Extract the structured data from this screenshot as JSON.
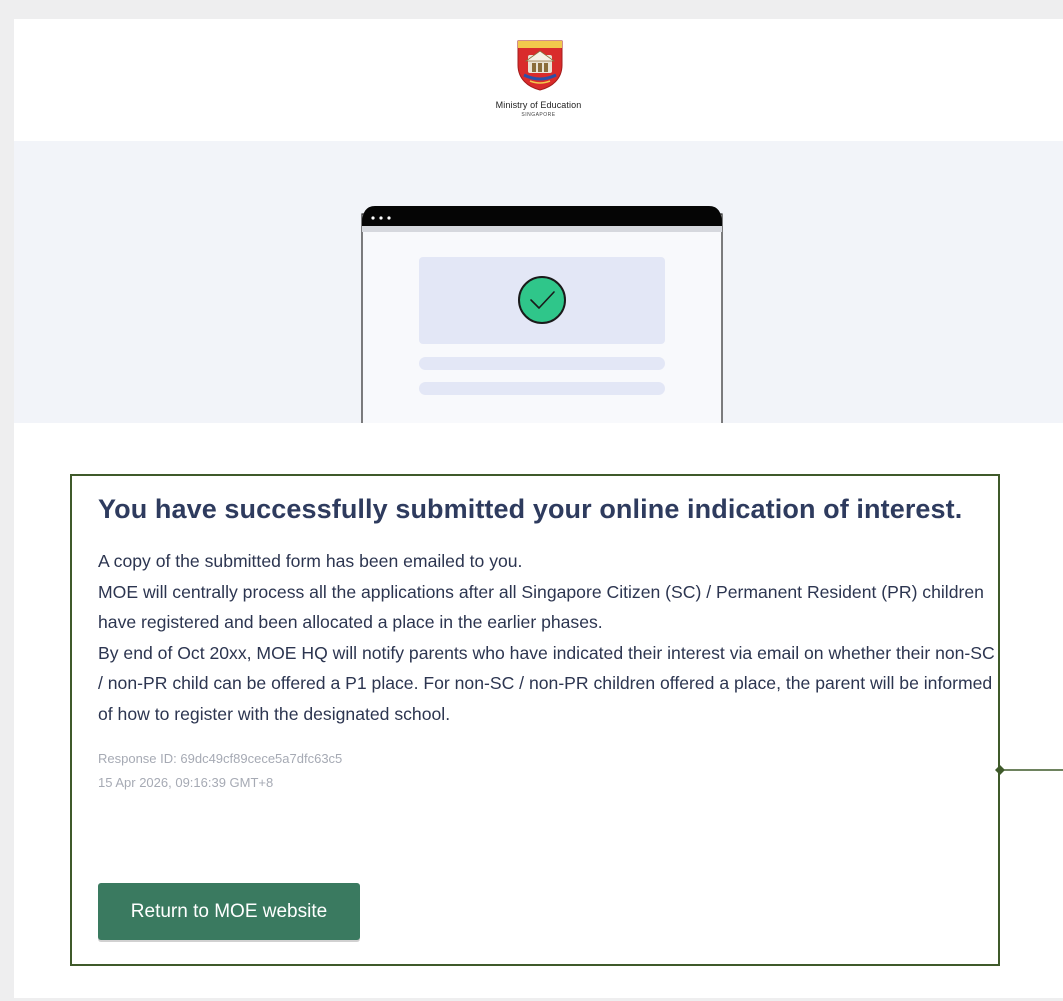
{
  "brand": {
    "name": "Ministry of Education",
    "subtitle": "SINGAPORE"
  },
  "content": {
    "headline": "You have successfully submitted your online indication of interest.",
    "paragraphs": [
      "A copy of the submitted form has been emailed to you.",
      "MOE will centrally process all the applications after all Singapore Citizen (SC) / Permanent Resident (PR) children have registered and been allocated a place in the earlier phases.",
      "By end of Oct 20xx, MOE HQ will notify parents who have indicated their interest via email on whether their non-SC / non-PR child can be offered a P1 place. For non-SC / non-PR children offered a place, the parent will be informed of how to register with the designated school."
    ],
    "response_id": "Response ID: 69dc49cf89cece5a7dfc63c5",
    "timestamp": "15 Apr 2026, 09:16:39 GMT+8",
    "return_button": "Return to MOE website"
  },
  "icons": {
    "crest": "moe-crest-icon",
    "success": "check-circle-icon"
  },
  "colors": {
    "accent": "#3a7a60",
    "success": "#2fc68a",
    "crest_red": "#d92b2b",
    "outline": "#3f5a2a"
  }
}
